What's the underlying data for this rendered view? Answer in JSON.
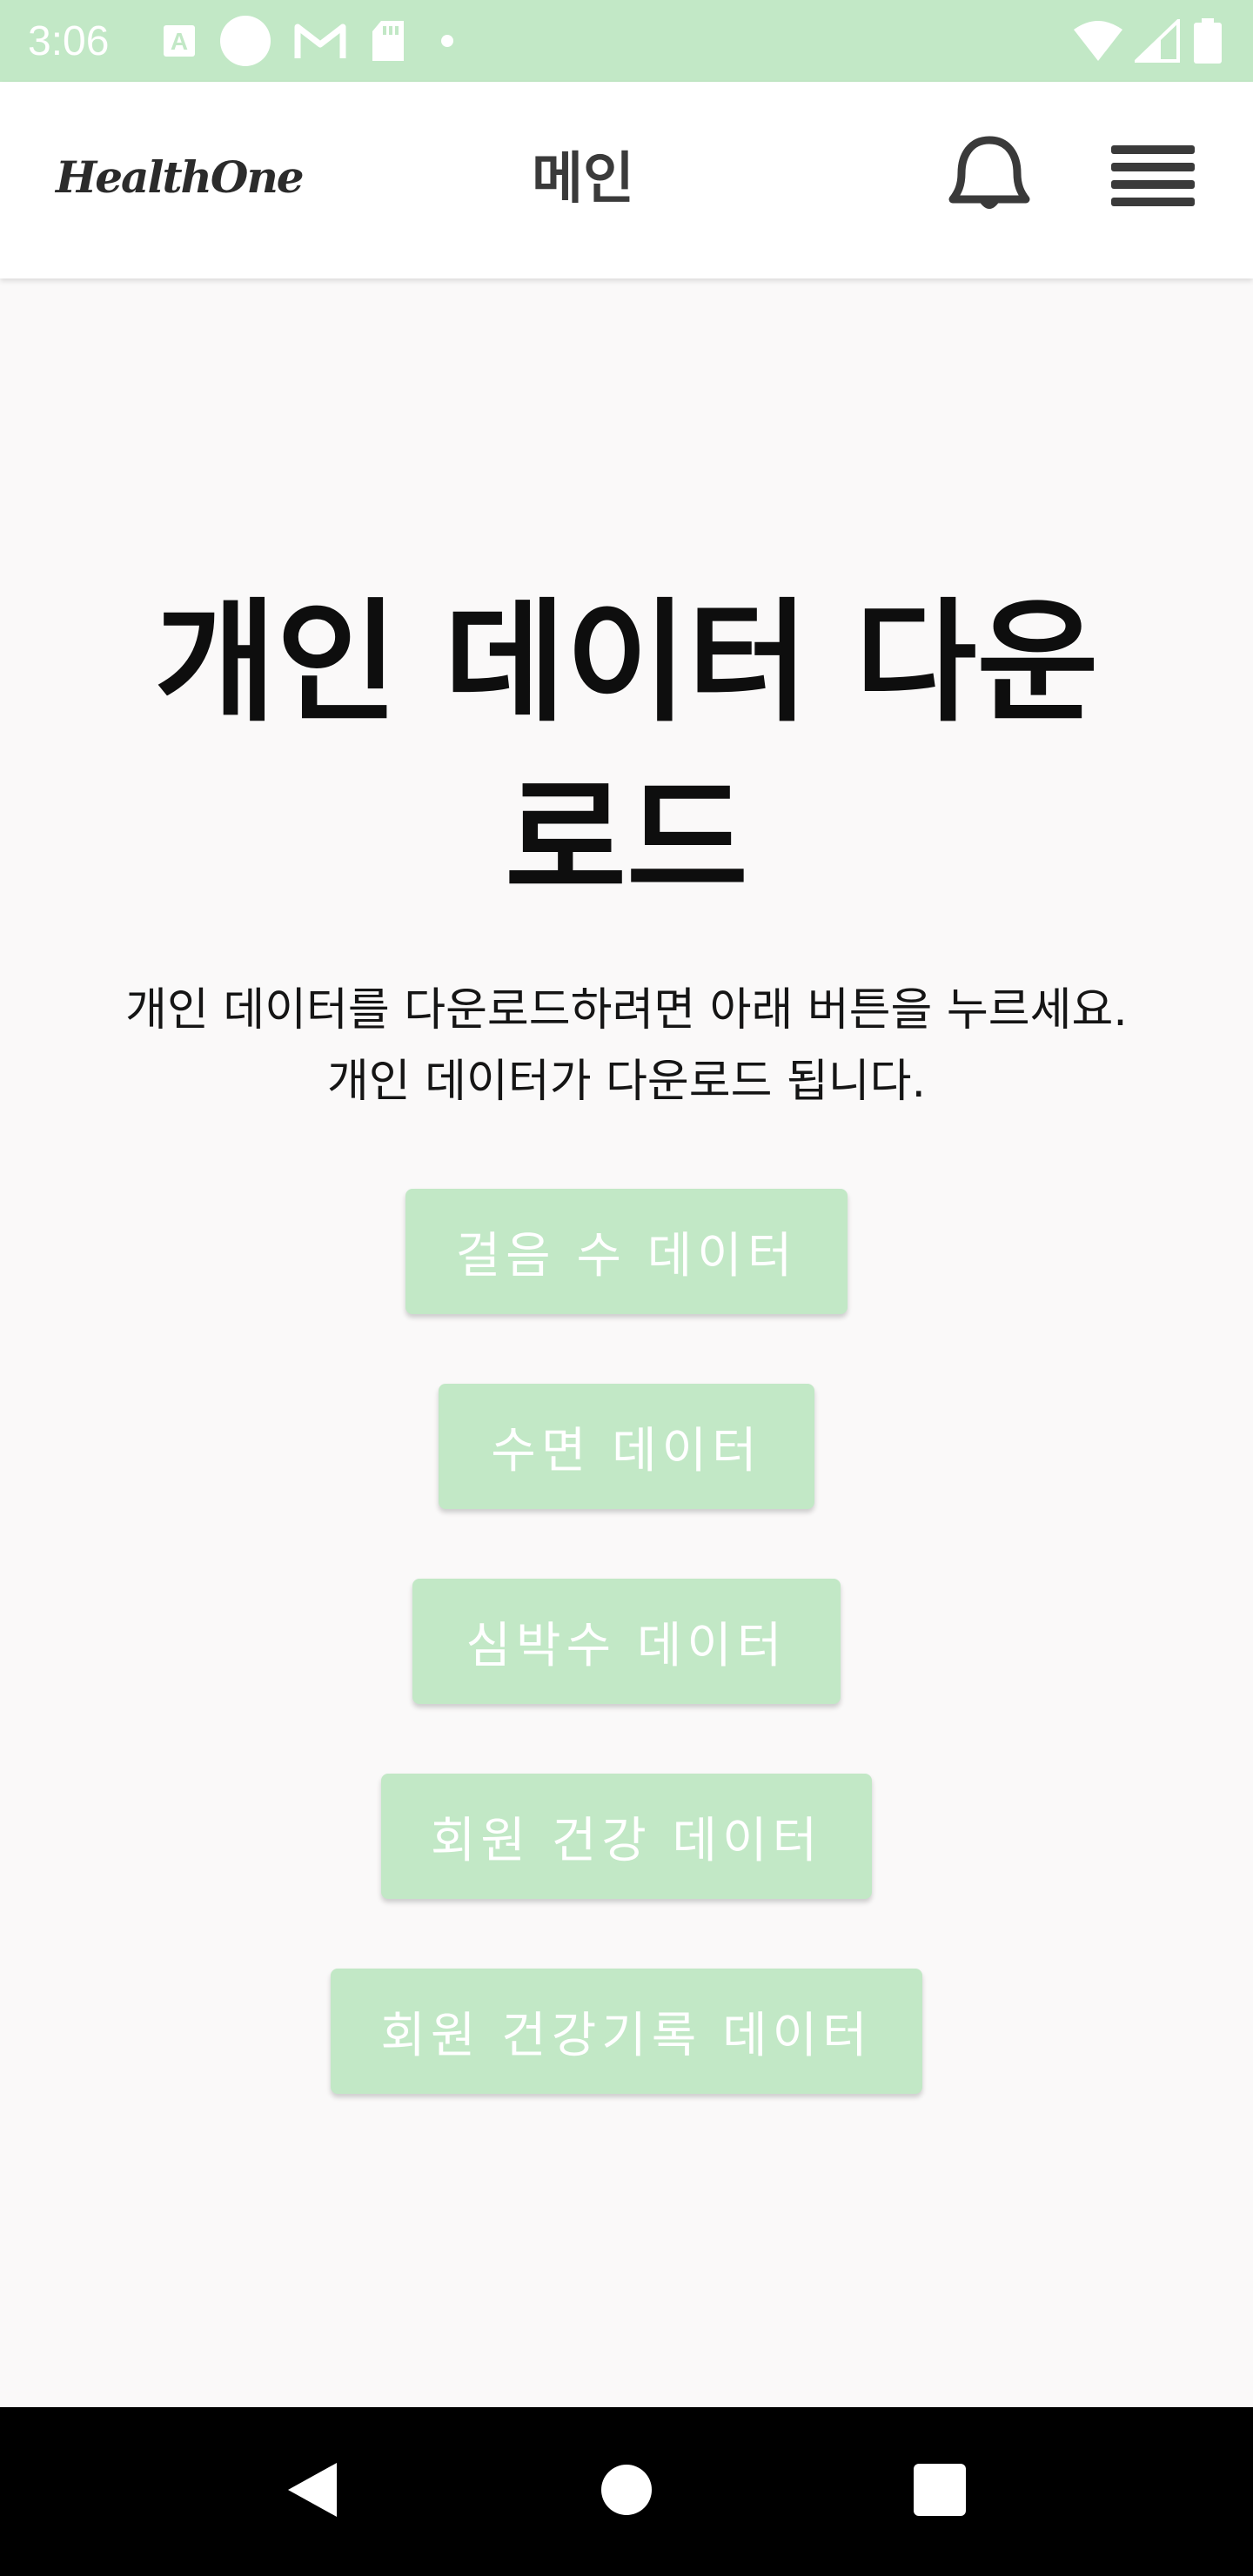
{
  "status_bar": {
    "time": "3:06",
    "background": "#c2e8c6",
    "left_icons": [
      "a-box-icon",
      "circle-icon",
      "gmail-icon",
      "sd-card-icon",
      "dot-icon"
    ],
    "right_icons": [
      "wifi-icon",
      "signal-icon",
      "battery-icon"
    ]
  },
  "app_bar": {
    "logo": "HealthOne",
    "title": "메인",
    "icons": [
      "bell-icon",
      "menu-icon"
    ]
  },
  "main": {
    "heading": "개인 데이터 다운로드",
    "description": "개인 데이터를 다운로드하려면 아래 버튼을 누르세요. 개인 데이터가 다운로드 됩니다.",
    "buttons": [
      {
        "label": "걸음 수 데이터"
      },
      {
        "label": "수면 데이터"
      },
      {
        "label": "심박수 데이터"
      },
      {
        "label": "회원 건강 데이터"
      },
      {
        "label": "회원 건강기록 데이터"
      }
    ],
    "button_color": "#c2e8c6",
    "button_text_color": "#ffffff"
  },
  "nav_bar": {
    "icons": [
      "back-icon",
      "home-icon",
      "recent-apps-icon"
    ]
  }
}
